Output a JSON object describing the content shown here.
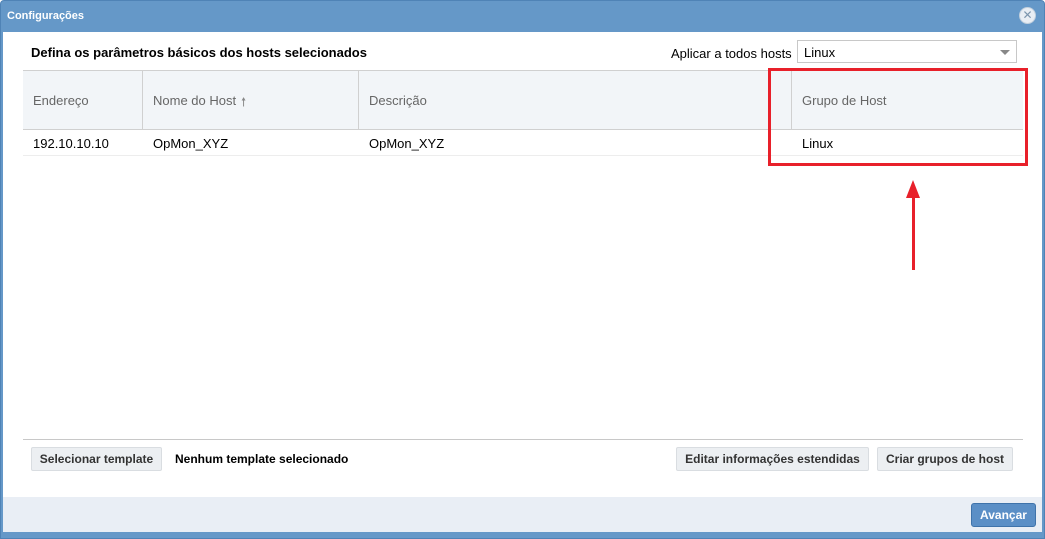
{
  "window": {
    "title": "Configurações",
    "close_icon": "close-circle-icon"
  },
  "panel": {
    "title": "Defina os parâmetros básicos dos hosts selecionados",
    "apply_all_label": "Aplicar a todos hosts",
    "apply_all_value": "Linux"
  },
  "grid": {
    "columns": [
      "Endereço",
      "Nome do Host",
      "Descrição",
      "Grupo de Host"
    ],
    "sort_icon": "sort-ascending-icon",
    "rows": [
      [
        "192.10.10.10",
        "OpMon_XYZ",
        "OpMon_XYZ",
        "Linux"
      ]
    ]
  },
  "toolbar": {
    "select_template_label": "Selecionar template",
    "template_status": "Nenhum template selecionado",
    "edit_extended_label": "Editar informações estendidas",
    "create_groups_label": "Criar grupos de host"
  },
  "footer": {
    "next_label": "Avançar"
  },
  "annotation": {
    "color": "#e8202a"
  }
}
